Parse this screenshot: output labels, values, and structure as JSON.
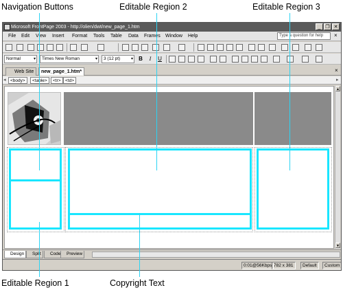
{
  "callouts": {
    "nav_buttons": "Navigation Buttons",
    "editable2": "Editable Region 2",
    "editable3": "Editable Region 3",
    "editable1": "Editable Region 1",
    "copyright": "Copyright Text"
  },
  "window": {
    "title": "Microsoft FrontPage 2003 - http://olien/dwt/new_page_1.htm",
    "min_glyph": "_",
    "restore_glyph": "❐",
    "close_glyph": "✕"
  },
  "menu": {
    "items": [
      "File",
      "Edit",
      "View",
      "Insert",
      "Format",
      "Tools",
      "Table",
      "Data",
      "Frames",
      "Window",
      "Help"
    ],
    "ask_placeholder": "Type a question for help",
    "close_glyph": "×"
  },
  "format_toolbar": {
    "style_value": "Normal",
    "font_value": "Times New Roman",
    "size_value": "3 (12 pt)",
    "bold": "B",
    "italic": "I",
    "underline": "U",
    "dropdown_arrow": "▾"
  },
  "tabs": {
    "web_site": "Web Site",
    "page": "new_page_1.htm*",
    "close_glyph": "×"
  },
  "quick_tags": {
    "items": [
      "<body>",
      "<table>",
      "<tr>",
      "<td>"
    ],
    "left_arrow": "◂",
    "right_arrow": "▸"
  },
  "view_tabs": {
    "items": [
      "Design",
      "Split",
      "Code",
      "Preview"
    ]
  },
  "status": {
    "download": "0:01@56Kbps",
    "dimensions": "782 x 381",
    "mode1": "Default",
    "mode2": "Custom"
  },
  "colors": {
    "accent": "#19e6ff",
    "region_gray": "#8a8a8a"
  }
}
